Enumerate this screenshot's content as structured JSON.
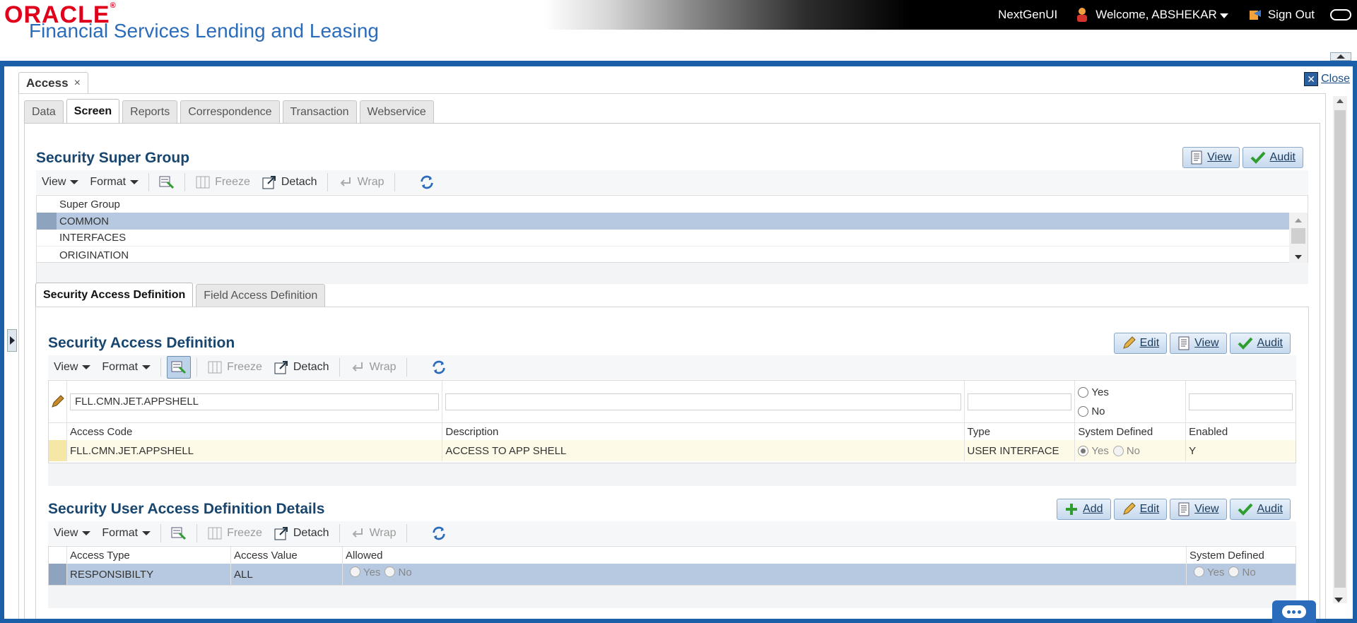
{
  "brand": {
    "logo_text": "ORACLE",
    "product": "Financial Services Lending and Leasing"
  },
  "user": {
    "nextgen": "NextGenUI",
    "welcome": "Welcome, ABSHEKAR",
    "signout": "Sign Out"
  },
  "doc_tab": {
    "label": "Access",
    "close": "×"
  },
  "close_link": "Close",
  "tabs": [
    "Data",
    "Screen",
    "Reports",
    "Correspondence",
    "Transaction",
    "Webservice"
  ],
  "toolbar": {
    "view": "View",
    "format": "Format",
    "freeze": "Freeze",
    "detach": "Detach",
    "wrap": "Wrap"
  },
  "buttons": {
    "add": "Add",
    "edit": "Edit",
    "view": "View",
    "audit": "Audit"
  },
  "super_group": {
    "title": "Security Super Group",
    "header": "Super Group",
    "rows": [
      "COMMON",
      "INTERFACES",
      "ORIGINATION"
    ]
  },
  "subtabs": [
    "Security Access Definition",
    "Field Access Definition"
  ],
  "access_def": {
    "title": "Security Access Definition",
    "filter": {
      "code": "FLL.CMN.JET.APPSHELL",
      "yes": "Yes",
      "no": "No"
    },
    "headers": [
      "Access Code",
      "Description",
      "Type",
      "System Defined",
      "Enabled"
    ],
    "row": {
      "code": "FLL.CMN.JET.APPSHELL",
      "desc": "ACCESS TO APP SHELL",
      "type": "USER INTERFACE",
      "yes": "Yes",
      "no": "No",
      "enabled": "Y"
    }
  },
  "user_access": {
    "title": "Security User Access Definition Details",
    "headers": [
      "Access Type",
      "Access Value",
      "Allowed",
      "System Defined"
    ],
    "row": {
      "type": "RESPONSIBILTY",
      "value": "ALL",
      "yes": "Yes",
      "no": "No"
    }
  },
  "colors": {
    "brand_red": "#e0001b",
    "accent_blue": "#1a5fa8",
    "title_blue": "#18466e"
  },
  "icons": [
    "user-icon",
    "signout-icon",
    "close-icon",
    "view-icon",
    "audit-check-icon",
    "edit-pencil-icon",
    "add-plus-icon",
    "refresh-icon",
    "freeze-icon",
    "detach-icon",
    "wrap-icon",
    "query-by-example-icon",
    "chat-icon"
  ]
}
